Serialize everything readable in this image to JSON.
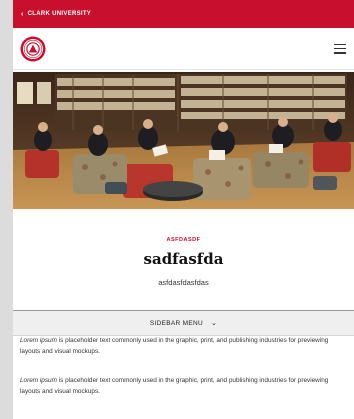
{
  "topbar": {
    "back_label": "CLARK UNIVERSITY",
    "color": "#c8102e"
  },
  "header": {
    "logo_icon": "clark-seal-icon",
    "menu_icon": "hamburger-icon"
  },
  "hero": {
    "image": "library-students-photo"
  },
  "content": {
    "eyebrow": "ASFDASDF",
    "title": "sadfasfda",
    "subtitle": "asfdasfdasfdas"
  },
  "sidebar_menu": {
    "label": "SIDEBAR MENU",
    "icon": "chevron-down-icon"
  },
  "paragraphs": [
    {
      "emphasis": "Lorem ipsum",
      "text": " is placeholder text commonly used in the graphic, print, and publishing industries for previewing layouts and visual mockups."
    },
    {
      "emphasis": "Lorem ipsum",
      "text": " is placeholder text commonly used in the graphic, print, and publishing industries for previewing layouts and visual mockups."
    }
  ]
}
